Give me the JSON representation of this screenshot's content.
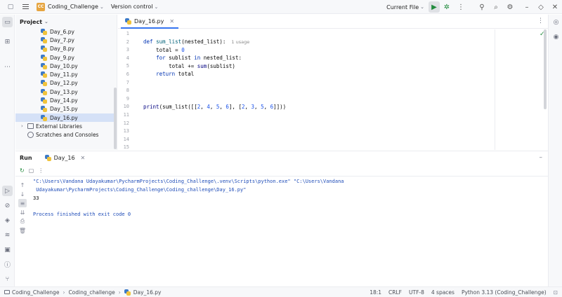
{
  "titlebar": {
    "project_badge": "CC",
    "project_name": "Coding_Challenge",
    "vcs": "Version control",
    "run_config": "Current File"
  },
  "project_pane": {
    "title": "Project",
    "files": [
      "Day_6.py",
      "Day_7.py",
      "Day_8.py",
      "Day_9.py",
      "Day_10.py",
      "Day_11.py",
      "Day_12.py",
      "Day_13.py",
      "Day_14.py",
      "Day_15.py",
      "Day_16.py"
    ],
    "selected": "Day_16.py",
    "external_libraries": "External Libraries",
    "scratches": "Scratches and Consoles"
  },
  "editor": {
    "tab": "Day_16.py",
    "line_numbers": [
      "1",
      "2",
      "3",
      "4",
      "5",
      "6",
      "7",
      "8",
      "9",
      "10",
      "11",
      "12",
      "13",
      "14",
      "15"
    ],
    "usage_hint": "1 usage"
  },
  "run": {
    "title": "Run",
    "tab": "Day_16",
    "console": {
      "line1": "\"C:\\Users\\Vandana Udayakumar\\PycharmProjects\\Coding_Challenge\\.venv\\Scripts\\python.exe\" \"C:\\Users\\Vandana",
      "line2": " Udayakumar\\PycharmProjects\\Coding_Challenge\\Coding_challenge\\Day_16.py\"",
      "line3": "33",
      "line4": "Process finished with exit code 0"
    }
  },
  "statusbar": {
    "crumbs": [
      "Coding_Challenge",
      "Coding_challenge",
      "Day_16.py"
    ],
    "position": "18:1",
    "line_sep": "CRLF",
    "encoding": "UTF-8",
    "indent": "4 spaces",
    "interpreter": "Python 3.13 (Coding_Challenge)"
  },
  "colors": {
    "accent": "#3574f0",
    "run_green": "#208a3c"
  }
}
